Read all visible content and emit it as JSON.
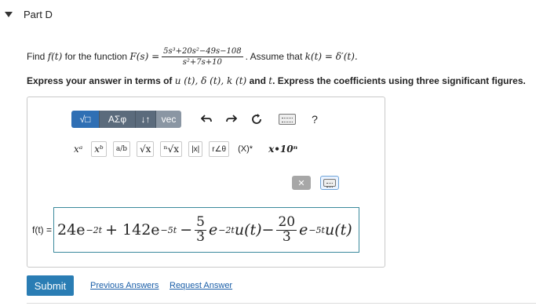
{
  "part": {
    "title": "Part D"
  },
  "problem": {
    "find_prefix": "Find",
    "f_of_t": "f(t)",
    "for_the_function": "for the function",
    "F_of_s": "F(s) =",
    "numerator": "5s³+20s²−49s−108",
    "denominator": "s²+7s+10",
    "assume_text": ". Assume that",
    "assume_math": "k(t) = δ′(t)."
  },
  "instruction": {
    "prefix": "Express your answer in terms of",
    "math_terms": "u (t), δ (t), k (t)",
    "mid": "and",
    "math_t": "t",
    "suffix": ". Express the coefficients using three significant figures."
  },
  "toolbar": {
    "templates_label": "√□",
    "greek_label": "ΑΣφ",
    "arrows_label": "↓↑",
    "vec_label": "vec",
    "undo_icon": "undo-icon",
    "redo_icon": "redo-icon",
    "reset_icon": "reset-icon",
    "keyboard_icon": "keyboard-icon",
    "help_label": "?",
    "symbols": [
      {
        "name": "power-button",
        "label": "xᵃ"
      },
      {
        "name": "subscript-button",
        "label": "xᵇ"
      },
      {
        "name": "fraction-button",
        "label": "a/b"
      },
      {
        "name": "sqrt-button",
        "label": "√x"
      },
      {
        "name": "nth-root-button",
        "label": "ⁿ√x"
      },
      {
        "name": "abs-button",
        "label": "|x|"
      },
      {
        "name": "polar-button",
        "label": "r∠θ"
      },
      {
        "name": "conjugate-button",
        "label": "(X)*"
      },
      {
        "name": "sci-notation-button",
        "label": "x•10ⁿ"
      }
    ]
  },
  "side_controls": {
    "clear_label": "✕",
    "keyboard_label": "keyboard"
  },
  "answer": {
    "label": "f(t) =",
    "t1": "24e",
    "e1": "−2t",
    "t2": "+ 142e",
    "e2": "−5t",
    "minus1": "−",
    "f1_num": "5",
    "f1_den": "3",
    "t3": "e",
    "e3": "−2t",
    "t4": "u(t)",
    "minus2": "−",
    "f2_num": "20",
    "f2_den": "3",
    "t5": "e",
    "e5": "−5t",
    "t6": "u(t)"
  },
  "actions": {
    "submit": "Submit",
    "previous_answers": "Previous Answers",
    "request_answer": "Request Answer"
  },
  "colors": {
    "submit_bg": "#2a7db4",
    "link": "#1a5ea8",
    "input_border": "#3b8a9c"
  }
}
